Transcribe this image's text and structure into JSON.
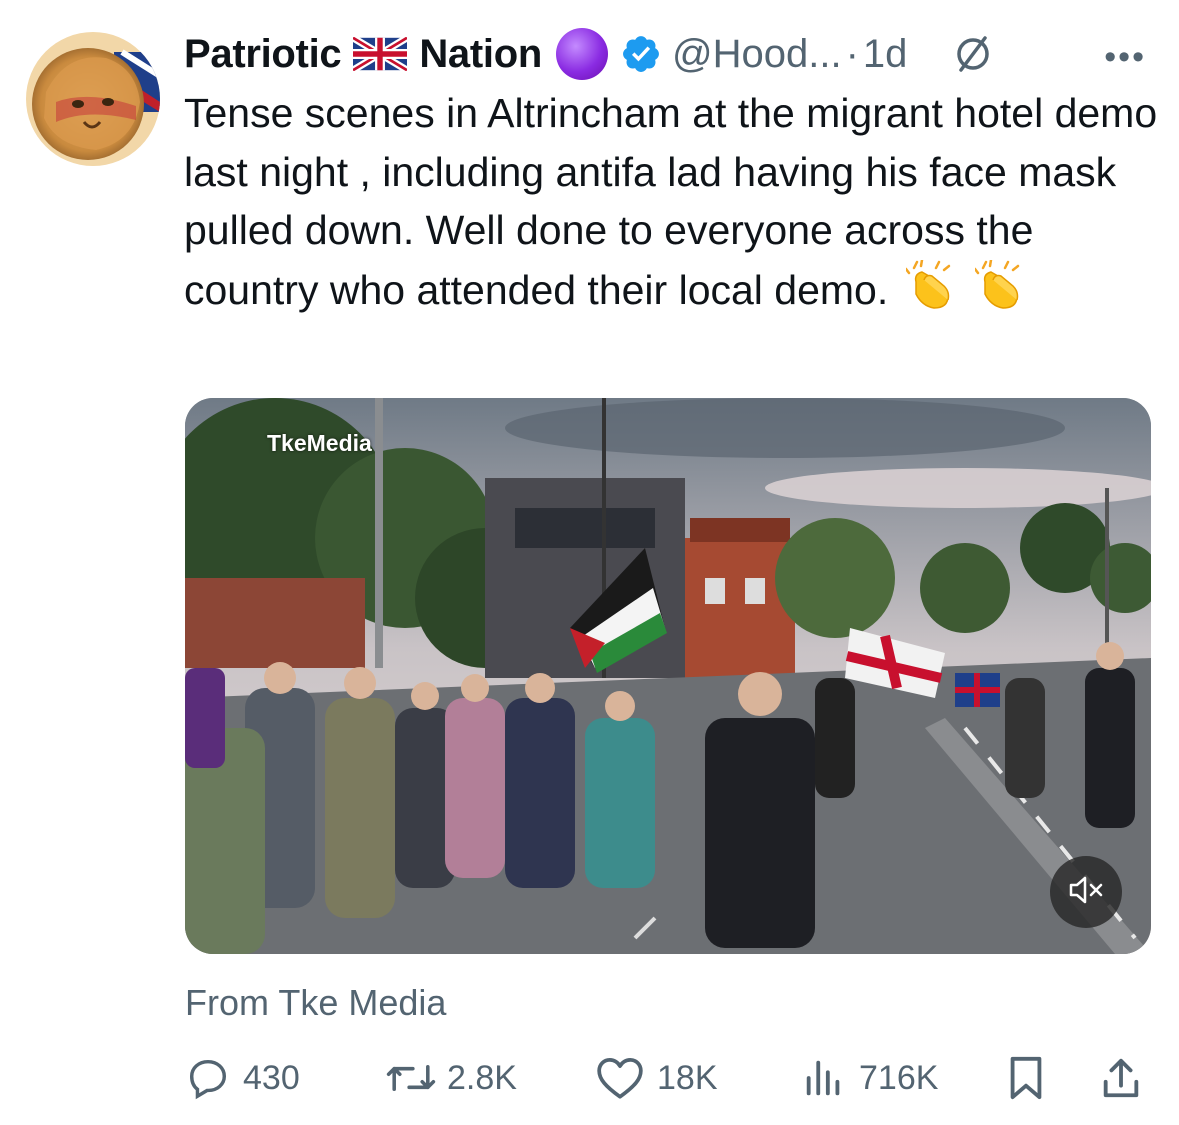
{
  "tweet": {
    "display_name_part1": "Patriotic",
    "display_name_part2": "Nation",
    "handle": "@Hood...",
    "separator": "·",
    "time": "1d",
    "more": "•••",
    "text": "Tense scenes in Altrincham at the migrant hotel demo last night , including antifa lad having his face mask pulled down. Well done to everyone across the country who attended their local demo.",
    "media_watermark": "TkeMedia",
    "source": "From Tke Media"
  },
  "icons": {
    "flag": "union-jack-flag-icon",
    "purple": "purple-circle-emoji",
    "verified": "verified-badge-icon",
    "no_symbol": "empty-set-icon",
    "clap": "clapping-hands-emoji",
    "mute": "speaker-muted-icon",
    "reply": "reply-icon",
    "retweet": "retweet-icon",
    "like": "heart-icon",
    "views": "views-icon",
    "bookmark": "bookmark-icon",
    "share": "share-icon"
  },
  "stats": {
    "replies": "430",
    "retweets": "2.8K",
    "likes": "18K",
    "views": "716K"
  },
  "colors": {
    "text": "#0f1419",
    "secondary": "#536471",
    "verified": "#1d9bf0",
    "purple": "#8a2be2"
  }
}
